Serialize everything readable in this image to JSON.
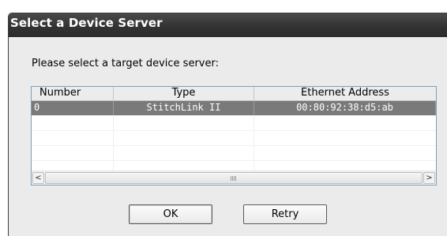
{
  "dialog": {
    "title": "Select a Device Server",
    "prompt": "Please select a target device server:"
  },
  "list": {
    "columns": [
      "Number",
      "Type",
      "Ethernet Address"
    ],
    "rows": [
      {
        "number": "0",
        "type": "StitchLink II",
        "ethernet_address": "00:80:92:38:d5:ab",
        "selected": true
      },
      {
        "number": "",
        "type": "",
        "ethernet_address": "",
        "selected": false
      },
      {
        "number": "",
        "type": "",
        "ethernet_address": "",
        "selected": false
      },
      {
        "number": "",
        "type": "",
        "ethernet_address": "",
        "selected": false
      },
      {
        "number": "",
        "type": "",
        "ethernet_address": "",
        "selected": false
      }
    ]
  },
  "scrollbar": {
    "left_arrow": "<",
    "right_arrow": ">"
  },
  "buttons": {
    "ok": "OK",
    "retry": "Retry"
  },
  "colors": {
    "titlebar": "#333333",
    "selection": "#7a7a7a",
    "dialog_bg": "#ebebeb"
  }
}
